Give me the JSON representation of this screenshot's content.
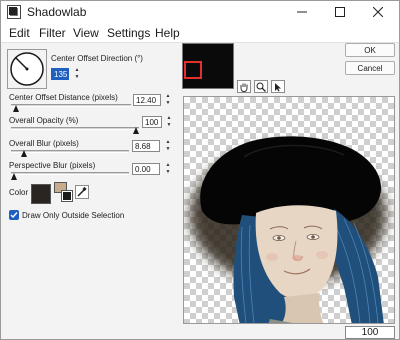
{
  "window": {
    "title": "Shadowlab"
  },
  "menu": [
    "Edit",
    "Filter",
    "View",
    "Settings",
    "Help"
  ],
  "controls": {
    "direction": {
      "label": "Center Offset Direction (°)",
      "value": "135"
    },
    "distance": {
      "label": "Center Offset Distance (pixels)",
      "value": "12.40"
    },
    "opacity": {
      "label": "Overall Opacity (%)",
      "value": "100"
    },
    "blur": {
      "label": "Overall Blur (pixels)",
      "value": "8.68"
    },
    "perspective": {
      "label": "Perspective Blur (pixels)",
      "value": "0.00"
    },
    "color": {
      "label": "Color",
      "swatch_primary": "#2a2521",
      "swatch_secondary": "#c8ab8d"
    },
    "draw_outside": {
      "label": "Draw Only Outside Selection",
      "checked": true
    }
  },
  "buttons": {
    "ok": "OK",
    "cancel": "Cancel"
  },
  "status": {
    "zoom": "100"
  },
  "colors": {
    "accent": "#1e5fbf",
    "navigator_frame": "#e03030",
    "hat": "#050505",
    "hair": "#1f4f7a",
    "skin": "#e7d6c4"
  },
  "icons": [
    "hand-icon",
    "zoom-icon",
    "pointer-icon",
    "dropper-icon",
    "check-icon"
  ]
}
